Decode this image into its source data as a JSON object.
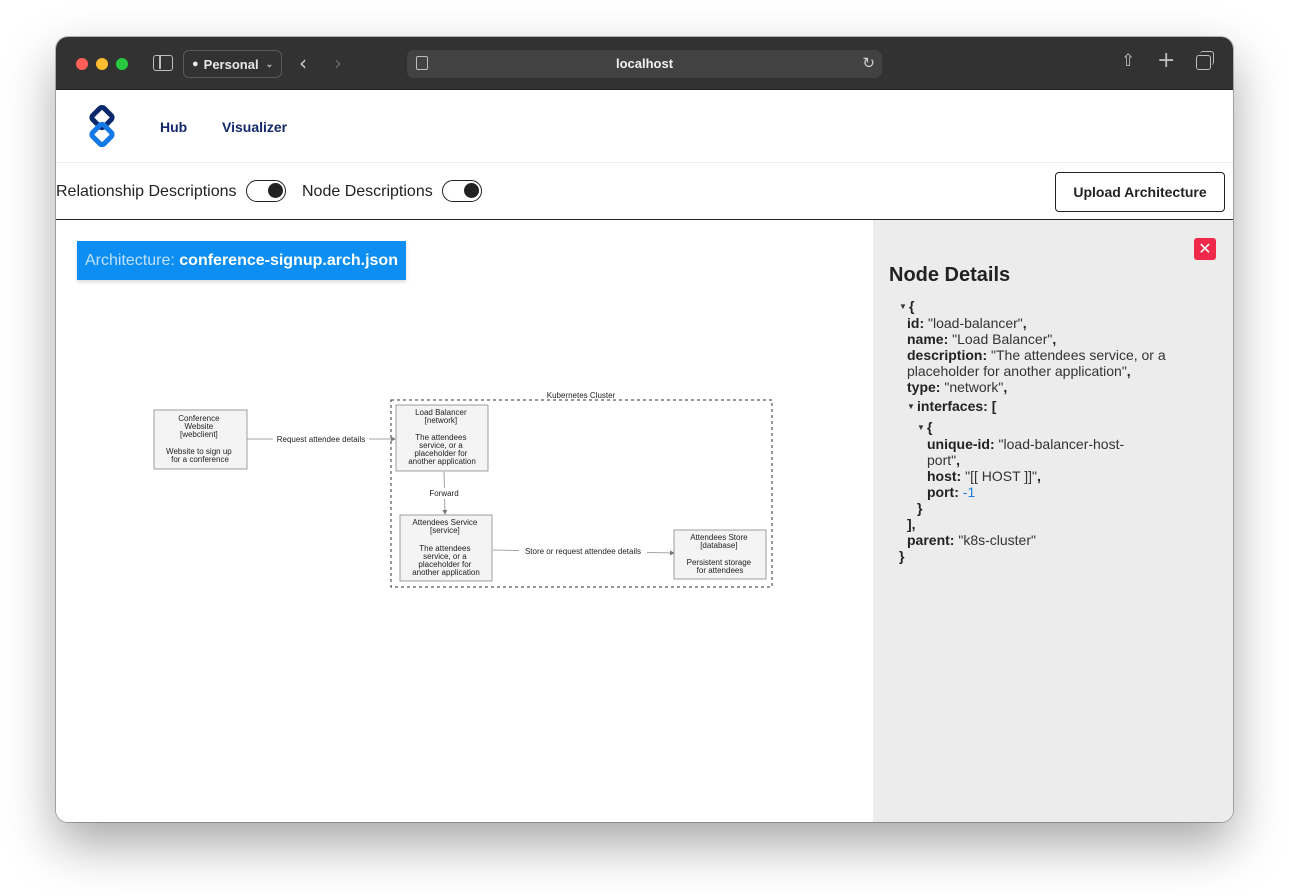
{
  "browser": {
    "profile_label": "Personal",
    "url": "localhost"
  },
  "nav": {
    "hub": "Hub",
    "visualizer": "Visualizer"
  },
  "toolbar": {
    "relationship_descriptions": "Relationship Descriptions",
    "node_descriptions": "Node Descriptions",
    "relationship_descriptions_on": true,
    "node_descriptions_on": true,
    "upload_label": "Upload Architecture"
  },
  "architecture": {
    "prefix": "Architecture:",
    "file": "conference-signup.arch.json"
  },
  "diagram": {
    "cluster_label": "Kubernetes Cluster",
    "nodes": {
      "website": [
        "Conference",
        "Website",
        "[webclient]",
        "",
        "Website to sign up",
        "for a conference"
      ],
      "load_balancer": [
        "Load Balancer",
        "[network]",
        "",
        "The attendees",
        "service, or a",
        "placeholder for",
        "another application"
      ],
      "attendees_service": [
        "Attendees Service",
        "[service]",
        "",
        "The attendees",
        "service, or a",
        "placeholder for",
        "another application"
      ],
      "attendees_store": [
        "Attendees Store",
        "[database]",
        "",
        "Persistent storage",
        "for attendees"
      ]
    },
    "edges": {
      "request": "Request attendee details",
      "forward": "Forward",
      "store": "Store or request attendee details"
    }
  },
  "details": {
    "title": "Node Details",
    "open_brace": "{",
    "close_brace": "}",
    "id_key": "id:",
    "id_val": "\"load-balancer\"",
    "name_key": "name:",
    "name_val": "\"Load Balancer\"",
    "desc_key": "description:",
    "desc_val_1": "\"The attendees service, or a",
    "desc_val_2": "placeholder for another application\"",
    "type_key": "type:",
    "type_val": "\"network\"",
    "interfaces_key": "interfaces:",
    "open_bracket": "[",
    "close_bracket": "],",
    "unique_id_key": "unique-id:",
    "unique_id_val_1": "\"load-balancer-host-",
    "unique_id_val_2": "port\"",
    "host_key": "host:",
    "host_val": "\"[[ HOST ]]\"",
    "port_key": "port:",
    "port_val": "-1",
    "parent_key": "parent:",
    "parent_val": "\"k8s-cluster\""
  }
}
